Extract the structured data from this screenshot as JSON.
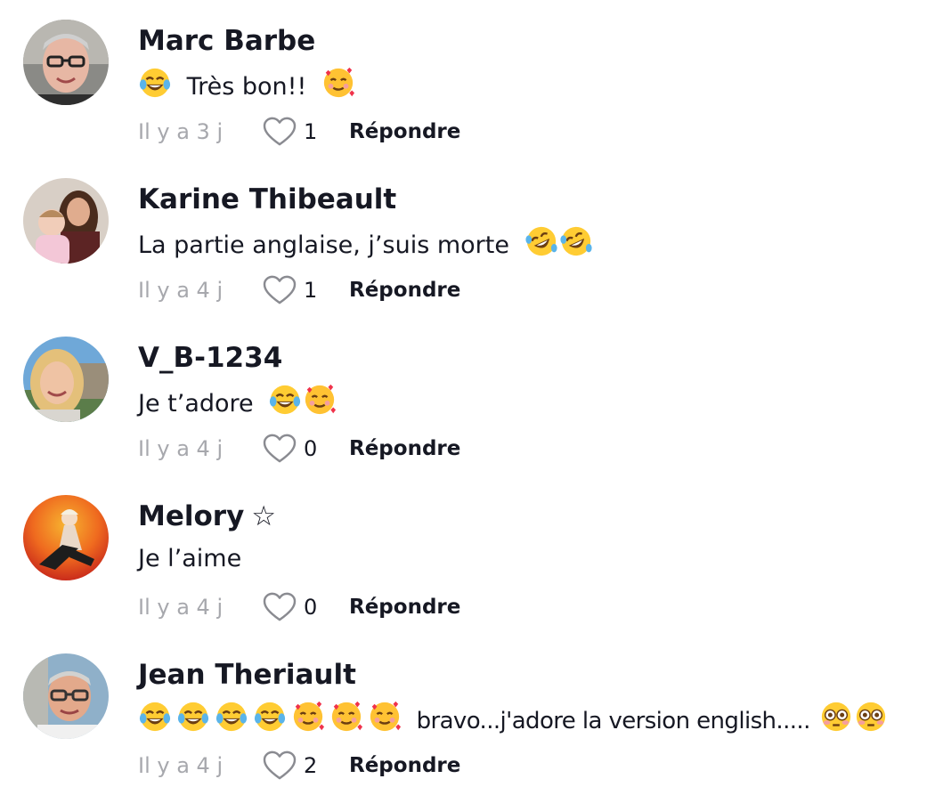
{
  "colors": {
    "text_primary": "#161823",
    "text_secondary": "#a7a8ad",
    "background": "#ffffff"
  },
  "comments": [
    {
      "username": "Marc Barbe",
      "text": "Très bon!!",
      "emojis_before": [
        "face-with-tears-of-joy-emoji"
      ],
      "emojis_after": [
        "smiling-face-with-hearts-emoji"
      ],
      "timestamp": "Il y a 3 j",
      "likes": "1",
      "reply_label": "Répondre",
      "avatar": "avatar-photo-man-glasses"
    },
    {
      "username": "Karine Thibeault",
      "text": "La partie anglaise, j’suis morte",
      "emojis_after": [
        "rolling-on-the-floor-laughing-emoji",
        "rolling-on-the-floor-laughing-emoji"
      ],
      "timestamp": "Il y a 4 j",
      "likes": "1",
      "reply_label": "Répondre",
      "avatar": "avatar-photo-woman-child"
    },
    {
      "username": "V_B-1234",
      "text": "Je t’adore",
      "emojis_after": [
        "face-with-tears-of-joy-emoji",
        "smiling-face-with-hearts-emoji"
      ],
      "timestamp": "Il y a 4 j",
      "likes": "0",
      "reply_label": "Répondre",
      "avatar": "avatar-photo-blonde-woman"
    },
    {
      "username": "Melory",
      "username_suffix": "☆",
      "text": "Je l’aime",
      "timestamp": "Il y a 4 j",
      "likes": "0",
      "reply_label": "Répondre",
      "avatar": "avatar-photo-red-artwork"
    },
    {
      "username": "Jean Theriault",
      "text": "bravo...j'adore la version english.....",
      "emojis_before": [
        "face-with-tears-of-joy-emoji",
        "face-with-tears-of-joy-emoji",
        "face-with-tears-of-joy-emoji",
        "face-with-tears-of-joy-emoji",
        "smiling-face-with-hearts-emoji",
        "smiling-face-with-hearts-emoji",
        "smiling-face-with-hearts-emoji"
      ],
      "emojis_after": [
        "flushed-face-emoji",
        "flushed-face-emoji"
      ],
      "timestamp": "Il y a 4 j",
      "likes": "2",
      "reply_label": "Répondre",
      "avatar": "avatar-photo-man-glasses-outdoor"
    }
  ]
}
